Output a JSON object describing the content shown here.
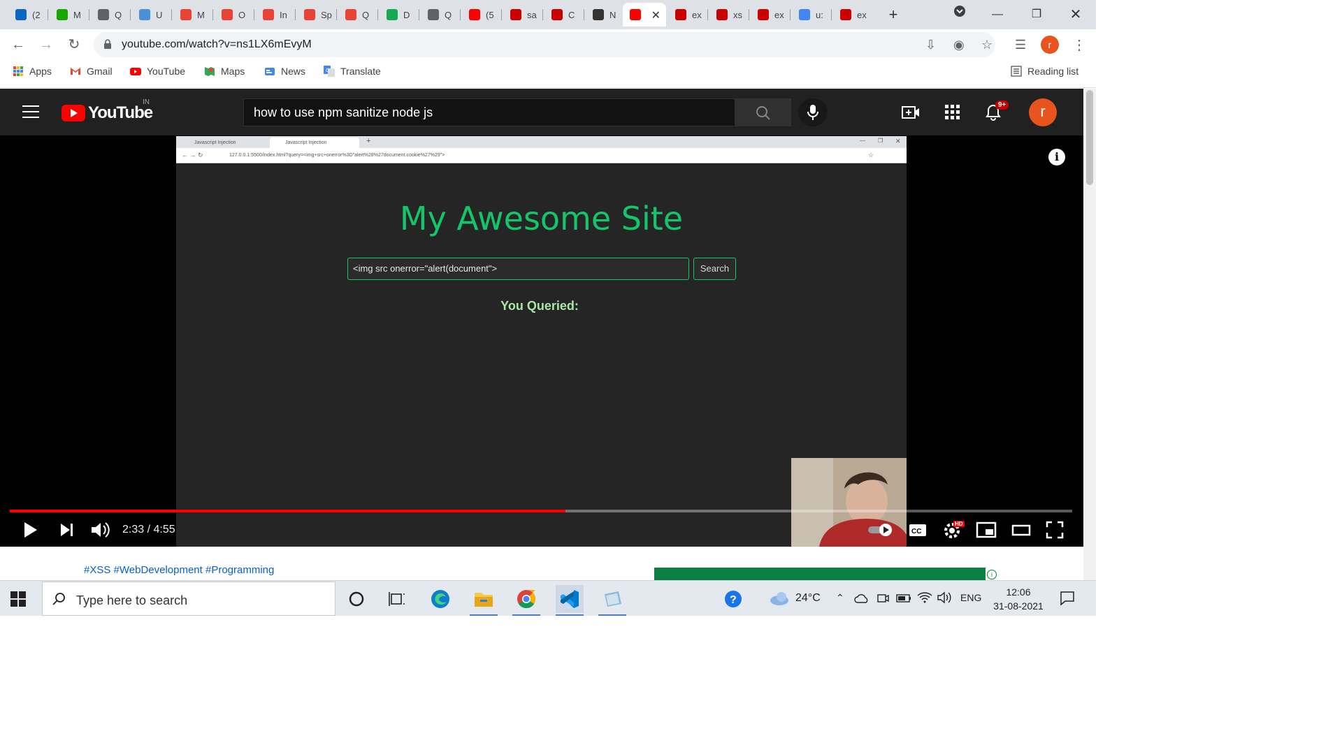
{
  "browser": {
    "tabs": [
      {
        "label": "(2",
        "icon": "linkedin-icon",
        "color": "#0a66c2"
      },
      {
        "label": "M",
        "icon": "upwork-icon",
        "color": "#14a800"
      },
      {
        "label": "Q",
        "icon": "globe-icon",
        "color": "#5f6368"
      },
      {
        "label": "U",
        "icon": "url-icon",
        "color": "#4a90d9"
      },
      {
        "label": "M",
        "icon": "gmail-icon",
        "color": "#ea4335"
      },
      {
        "label": "O",
        "icon": "gmail-icon",
        "color": "#ea4335"
      },
      {
        "label": "In",
        "icon": "gmail-icon",
        "color": "#ea4335"
      },
      {
        "label": "Sp",
        "icon": "gmail-icon",
        "color": "#ea4335"
      },
      {
        "label": "Q",
        "icon": "gmail-icon",
        "color": "#ea4335"
      },
      {
        "label": "D",
        "icon": "mongodb-leaf-icon",
        "color": "#13aa52"
      },
      {
        "label": "Q",
        "icon": "globe-icon",
        "color": "#5f6368"
      },
      {
        "label": "(5",
        "icon": "youtube-icon",
        "color": "#ff0000"
      },
      {
        "label": "sa",
        "icon": "npm-icon",
        "color": "#cb0000"
      },
      {
        "label": "C",
        "icon": "npm-icon",
        "color": "#cb0000"
      },
      {
        "label": "N",
        "icon": "github-icon",
        "color": "#333333"
      },
      {
        "label": "",
        "icon": "youtube-icon",
        "color": "#ff0000",
        "active": true
      },
      {
        "label": "ex",
        "icon": "npm-icon",
        "color": "#cb0000"
      },
      {
        "label": "xs",
        "icon": "npm-icon",
        "color": "#cb0000"
      },
      {
        "label": "ex",
        "icon": "npm-icon",
        "color": "#cb0000"
      },
      {
        "label": "u:",
        "icon": "google-icon",
        "color": "#4285f4"
      },
      {
        "label": "ex",
        "icon": "npm-icon",
        "color": "#cb0000"
      }
    ],
    "url": "youtube.com/watch?v=ns1LX6mEvyM",
    "profile_initial": "r",
    "bookmarks": [
      {
        "label": "Apps",
        "icon": "apps-grid-icon"
      },
      {
        "label": "Gmail",
        "icon": "gmail-icon"
      },
      {
        "label": "YouTube",
        "icon": "youtube-icon"
      },
      {
        "label": "Maps",
        "icon": "maps-icon"
      },
      {
        "label": "News",
        "icon": "news-icon"
      },
      {
        "label": "Translate",
        "icon": "translate-icon"
      }
    ],
    "reading_list": "Reading list"
  },
  "youtube": {
    "logo_text": "YouTube",
    "country": "IN",
    "search_query": "how to use npm sanitize node js",
    "notif_count": "9+",
    "avatar_initial": "r"
  },
  "video": {
    "inner_tabs": [
      "Javascript Injection",
      "Javascript Injection"
    ],
    "inner_url": "127.0.0.1:5500/index.html?query=<img+src+onerror%3D\"alert%28%27document.cookie%27%29\">",
    "site_title": "My Awesome Site",
    "input_value": "<img src onerror=\"alert(document\">",
    "search_button": "Search",
    "queried_label": "You Queried:",
    "time": "2:33 / 4:55",
    "progress": 0.523,
    "hd_badge": "HD"
  },
  "description": {
    "hashtags": "#XSS #WebDevelopment #Programming"
  },
  "taskbar": {
    "search_placeholder": "Type here to search",
    "weather": "24°C",
    "language": "ENG",
    "time": "12:06",
    "date": "31-08-2021"
  },
  "colors": {
    "youtube_red": "#ff0000",
    "site_green": "#14c66a",
    "yt_dark": "#212121"
  }
}
